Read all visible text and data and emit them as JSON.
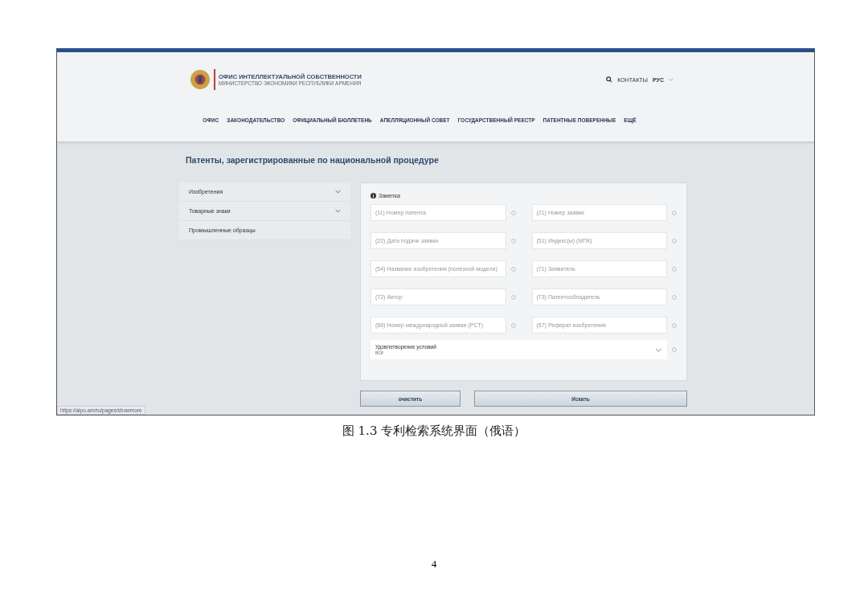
{
  "screenshot": {
    "header": {
      "org_title": "ОФИС ИНТЕЛЛЕКТУАЛЬНОЙ СОБСТВЕННОСТИ",
      "org_subtitle": "МИНИСТЕРСТВО ЭКОНОМИКИ РЕСПУБЛИКИ АРМЕНИЯ",
      "contacts": "КОНТАКТЫ",
      "language": "РУС"
    },
    "nav": [
      "ОФИС",
      "ЗАКОНОДАТЕЛЬСТВО",
      "ОФИЦИАЛЬНЫЙ БЮЛЛЕТЕНЬ",
      "АПЕЛЛЯЦИОННЫЙ СОВЕТ",
      "ГОСУДАРСТВЕННЫЙ РЕЕСТР",
      "ПАТЕНТНЫЕ ПОВЕРЕННЫЕ",
      "ЕЩЁ"
    ],
    "page_title": "Патенты, зарегистрированные по национальной процедуре",
    "sidebar": [
      {
        "label": "Изобретения",
        "expandable": true
      },
      {
        "label": "Товарные знаки",
        "expandable": true
      },
      {
        "label": "Промышленные образцы",
        "expandable": false
      }
    ],
    "form": {
      "note": "Заметка",
      "fields": [
        {
          "placeholder": "(11) Номер патента"
        },
        {
          "placeholder": "(21) Номер заявки"
        },
        {
          "placeholder": "(22) Дата подачи заявки"
        },
        {
          "placeholder": "(51) Индекс(ы) (МПК)"
        },
        {
          "placeholder": "(54) Название изобретения (полезной модели)"
        },
        {
          "placeholder": "(71) Заявитель"
        },
        {
          "placeholder": "(72) Автор"
        },
        {
          "placeholder": "(73) Патентообладатель"
        },
        {
          "placeholder": "(86) Номер международной заявки (PCT)"
        },
        {
          "placeholder": "(57) Реферат изобретения"
        }
      ],
      "select": {
        "label": "Удовлетворение условий",
        "value": "все"
      }
    },
    "buttons": [
      "очистить",
      "Искать"
    ],
    "status_url": "https://aipo.am/ru/pages/showmore"
  },
  "caption": "图 1.3  专利检索系统界面（俄语）",
  "page_number": "4"
}
